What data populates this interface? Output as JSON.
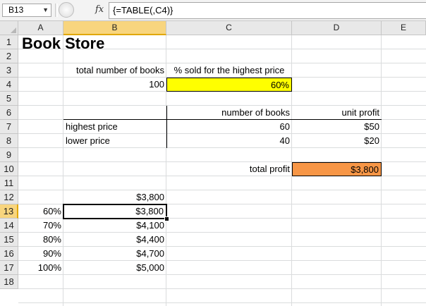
{
  "formula_bar": {
    "name_box": "B13",
    "fx_label": "fx",
    "formula": "{=TABLE(,C4)}"
  },
  "columns": [
    "A",
    "B",
    "C",
    "D",
    "E"
  ],
  "rows": [
    "1",
    "2",
    "3",
    "4",
    "5",
    "6",
    "7",
    "8",
    "9",
    "10",
    "11",
    "12",
    "13",
    "14",
    "15",
    "16",
    "17",
    "18"
  ],
  "active_cell": {
    "column": "B",
    "row": "13"
  },
  "sheet": {
    "title": "Book Store",
    "total_books_label": "total number of books",
    "pct_highest_label": "% sold for the highest price",
    "total_books_value": "100",
    "pct_highest_value": "60%",
    "number_of_books_header": "number of books",
    "unit_profit_header": "unit profit",
    "highest_price_label": "highest price",
    "lower_price_label": "lower price",
    "highest_books": "60",
    "lower_books": "40",
    "highest_profit": "$50",
    "lower_profit": "$20",
    "total_profit_label": "total profit",
    "total_profit_value": "$3,800",
    "data_table": {
      "header_result": "$3,800",
      "rows": [
        {
          "pct": "60%",
          "profit": "$3,800"
        },
        {
          "pct": "70%",
          "profit": "$4,100"
        },
        {
          "pct": "80%",
          "profit": "$4,400"
        },
        {
          "pct": "90%",
          "profit": "$4,700"
        },
        {
          "pct": "100%",
          "profit": "$5,000"
        }
      ]
    }
  },
  "colors": {
    "highlight_yellow": "#ffff00",
    "highlight_orange": "#f79646",
    "header_active": "#f8d57e"
  }
}
